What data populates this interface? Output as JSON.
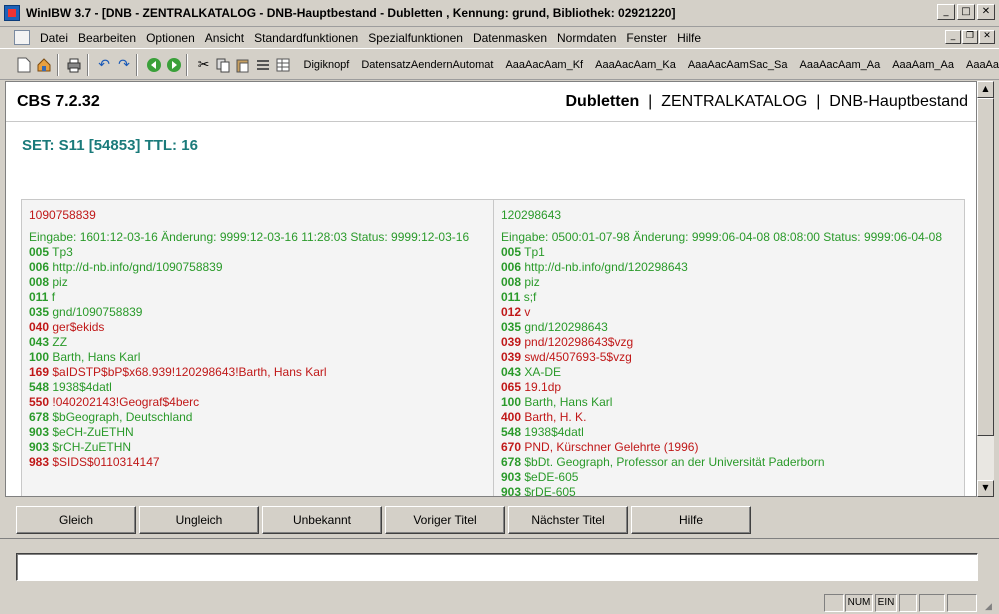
{
  "window": {
    "title": "WinIBW 3.7 - [DNB - ZENTRALKATALOG - DNB-Hauptbestand - Dubletten , Kennung: grund, Bibliothek: 02921220]",
    "buttons": [
      "_",
      "□",
      "✕"
    ]
  },
  "menu": {
    "items": [
      "Datei",
      "Bearbeiten",
      "Optionen",
      "Ansicht",
      "Standardfunktionen",
      "Spezialfunktionen",
      "Datenmasken",
      "Normdaten",
      "Fenster",
      "Hilfe"
    ],
    "mdi_buttons": [
      "_",
      "❐",
      "✕"
    ]
  },
  "toolbar": {
    "icons": [
      "new-document-icon",
      "home-icon",
      "print-icon",
      "undo-icon",
      "redo-icon",
      "back-icon",
      "forward-icon",
      "cut-icon",
      "copy-icon",
      "paste-icon",
      "list-icon",
      "table-icon"
    ],
    "text_buttons": [
      "Digiknopf",
      "DatensatzAendernAutomat",
      "AaaAacAam_Kf",
      "AaaAacAam_Ka",
      "AaaAacAamSac_Sa",
      "AaaAacAam_Aa",
      "AaaAam_Aa",
      "AaaAa"
    ]
  },
  "header": {
    "system": "CBS 7.2.32",
    "view": "Dubletten",
    "separator": "|",
    "catalog": "ZENTRALKATALOG",
    "database": "DNB-Hauptbestand"
  },
  "set": "SET: S11 [54853] TTL: 16",
  "records": {
    "left": {
      "id": "1090758839",
      "meta": "Eingabe: 1601:12-03-16 Änderung: 9999:12-03-16 11:28:03 Status: 9999:12-03-16",
      "lines": [
        {
          "tag": "005",
          "color": "green",
          "text": "Tp3"
        },
        {
          "tag": "006",
          "color": "green",
          "text": "http://d-nb.info/gnd/1090758839"
        },
        {
          "tag": "008",
          "color": "green",
          "text": "piz"
        },
        {
          "tag": "011",
          "color": "green",
          "text": "f"
        },
        {
          "tag": "035",
          "color": "green",
          "text": "gnd/1090758839"
        },
        {
          "tag": "040",
          "color": "red",
          "text": "ger$ekids"
        },
        {
          "tag": "043",
          "color": "green",
          "text": "ZZ"
        },
        {
          "tag": "100",
          "color": "green",
          "text": "Barth, Hans Karl"
        },
        {
          "tag": "169",
          "color": "red",
          "text": "$aIDSTP$bP$x68.939!120298643!Barth, Hans Karl"
        },
        {
          "tag": "548",
          "color": "green",
          "text": "1938$4datl"
        },
        {
          "tag": "550",
          "color": "red",
          "text": "!040202143!Geograf$4berc"
        },
        {
          "tag": "678",
          "color": "green",
          "text": "$bGeograph, Deutschland"
        },
        {
          "tag": "903",
          "color": "green",
          "text": "$eCH-ZuETHN"
        },
        {
          "tag": "903",
          "color": "green",
          "text": "$rCH-ZuETHN"
        },
        {
          "tag": "983",
          "color": "red",
          "text": "$SIDS$0110314147"
        }
      ]
    },
    "right": {
      "id": "120298643",
      "meta": "Eingabe: 0500:01-07-98 Änderung: 9999:06-04-08 08:08:00 Status: 9999:06-04-08",
      "lines": [
        {
          "tag": "005",
          "color": "green",
          "text": "Tp1"
        },
        {
          "tag": "006",
          "color": "green",
          "text": "http://d-nb.info/gnd/120298643"
        },
        {
          "tag": "008",
          "color": "green",
          "text": "piz"
        },
        {
          "tag": "011",
          "color": "green",
          "text": "s;f"
        },
        {
          "tag": "012",
          "color": "red",
          "text": "v"
        },
        {
          "tag": "035",
          "color": "green",
          "text": "gnd/120298643"
        },
        {
          "tag": "039",
          "color": "red",
          "text": "pnd/120298643$vzg"
        },
        {
          "tag": "039",
          "color": "red",
          "text": "swd/4507693-5$vzg"
        },
        {
          "tag": "043",
          "color": "green",
          "text": "XA-DE"
        },
        {
          "tag": "065",
          "color": "red",
          "text": "19.1dp"
        },
        {
          "tag": "100",
          "color": "green",
          "text": "Barth, Hans Karl"
        },
        {
          "tag": "400",
          "color": "red",
          "text": "Barth, H. K."
        },
        {
          "tag": "548",
          "color": "green",
          "text": "1938$4datl"
        },
        {
          "tag": "670",
          "color": "red",
          "text": "PND, Kürschner Gelehrte (1996)"
        },
        {
          "tag": "678",
          "color": "green",
          "text": "$bDt. Geograph, Professor an der Universität Paderborn"
        },
        {
          "tag": "903",
          "color": "green",
          "text": "$eDE-605"
        },
        {
          "tag": "903",
          "color": "green",
          "text": "$rDE-605"
        }
      ]
    }
  },
  "buttons": [
    "Gleich",
    "Ungleich",
    "Unbekannt",
    "Voriger Titel",
    "Nächster Titel",
    "Hilfe"
  ],
  "command": {
    "value": ""
  },
  "status": {
    "num": "NUM",
    "ein": "EIN"
  },
  "colors": {
    "green": "#2a9a2a",
    "red": "#c01818",
    "teal": "#1a7a7a"
  }
}
